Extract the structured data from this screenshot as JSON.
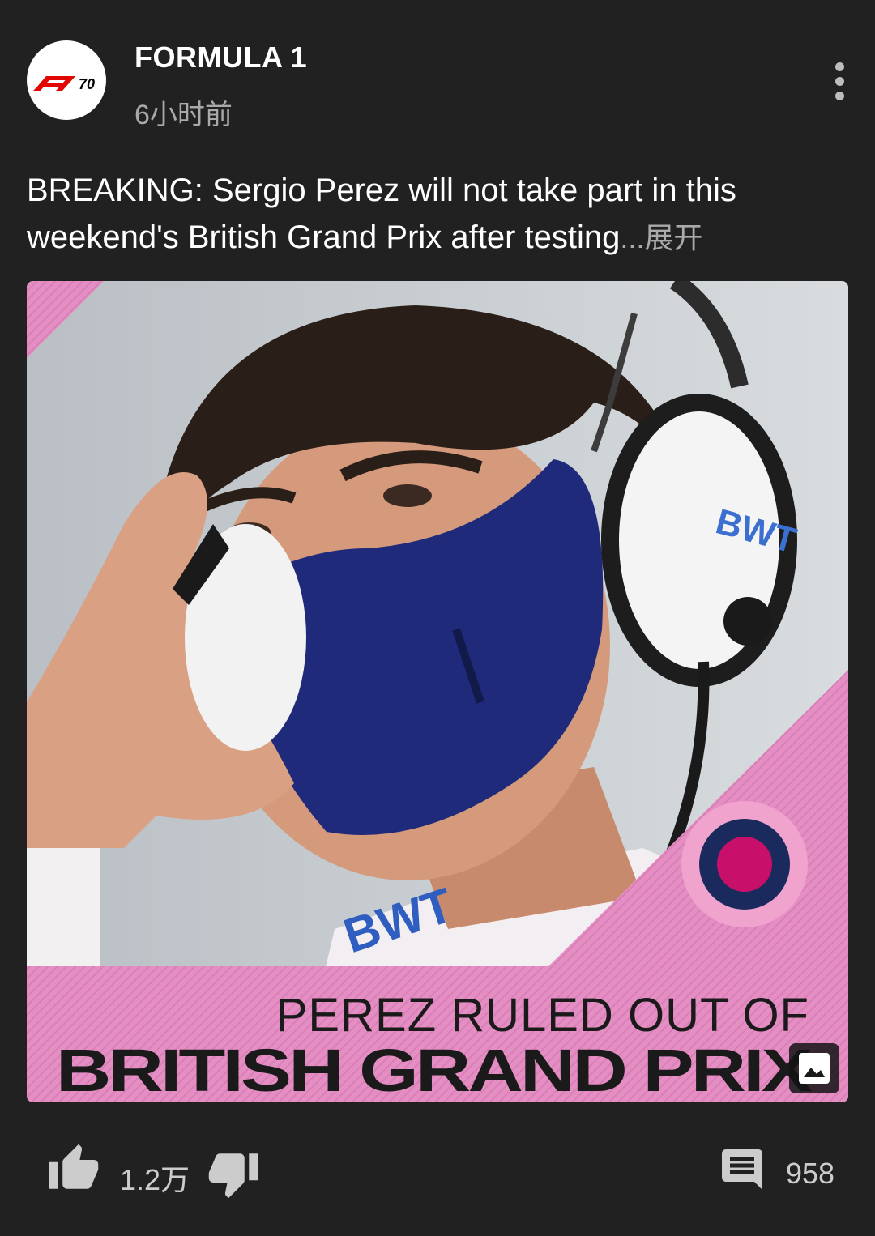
{
  "header": {
    "channel_name": "FORMULA 1",
    "time_ago": "6小时前",
    "logo_text": "F1 70"
  },
  "post": {
    "text": "BREAKING: Sergio Perez will not take part in this weekend's British Grand Prix after testing",
    "ellipsis": "...",
    "expand_label": "展开"
  },
  "image": {
    "headline_line1": "PEREZ RULED OUT OF",
    "headline_line2": "BRITISH GRAND PRIX",
    "sponsor_text": "BWT",
    "accent_pink": "#e48ec3",
    "mask_blue": "#1f2a7a",
    "roundel_red": "#c8106a",
    "roundel_navy": "#1b2a5c"
  },
  "actions": {
    "like_count": "1.2万",
    "comment_count": "958"
  },
  "icons": {
    "more": "more-vert-icon",
    "like": "thumb-up-icon",
    "dislike": "thumb-down-icon",
    "comment": "comment-icon",
    "gallery": "image-icon"
  }
}
